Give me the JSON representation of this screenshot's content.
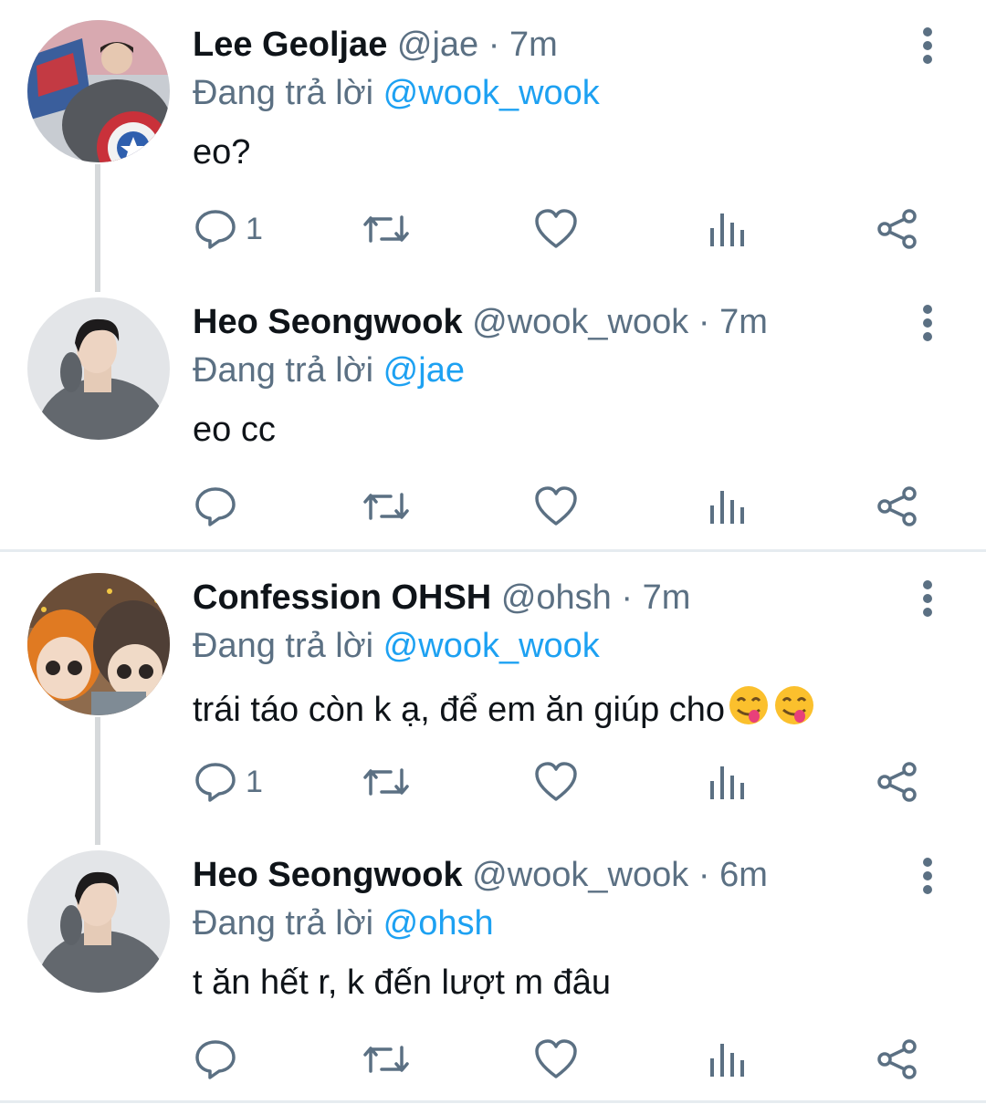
{
  "replying_prefix": "Đang trả lời",
  "tweets": [
    {
      "name": "Lee Geoljae",
      "handle": "@jae",
      "separator": "·",
      "time": "7m",
      "replying_to": "@wook_wook",
      "text": "eo?",
      "reply_count": "1",
      "avatar": "superhero-shield"
    },
    {
      "name": "Heo Seongwook",
      "handle": "@wook_wook",
      "separator": "·",
      "time": "7m",
      "replying_to": "@jae",
      "text": "eo cc",
      "reply_count": "",
      "avatar": "person-grey-sweater"
    },
    {
      "name": "Confession OHSH",
      "handle": "@ohsh",
      "separator": "·",
      "time": "7m",
      "replying_to": "@wook_wook",
      "text": "trái táo còn k ạ, để em ăn giúp cho",
      "emoji_count": 2,
      "reply_count": "1",
      "avatar": "cartoon-dolls"
    },
    {
      "name": "Heo Seongwook",
      "handle": "@wook_wook",
      "separator": "·",
      "time": "6m",
      "replying_to": "@ohsh",
      "text": "t ăn hết r, k đến lượt m đâu",
      "reply_count": "",
      "avatar": "person-grey-sweater"
    }
  ],
  "colors": {
    "link": "#1da1f2",
    "secondary": "#5b7083",
    "text": "#0f1419",
    "thread_line": "#d6d9db",
    "divider": "#e6ecf0"
  }
}
